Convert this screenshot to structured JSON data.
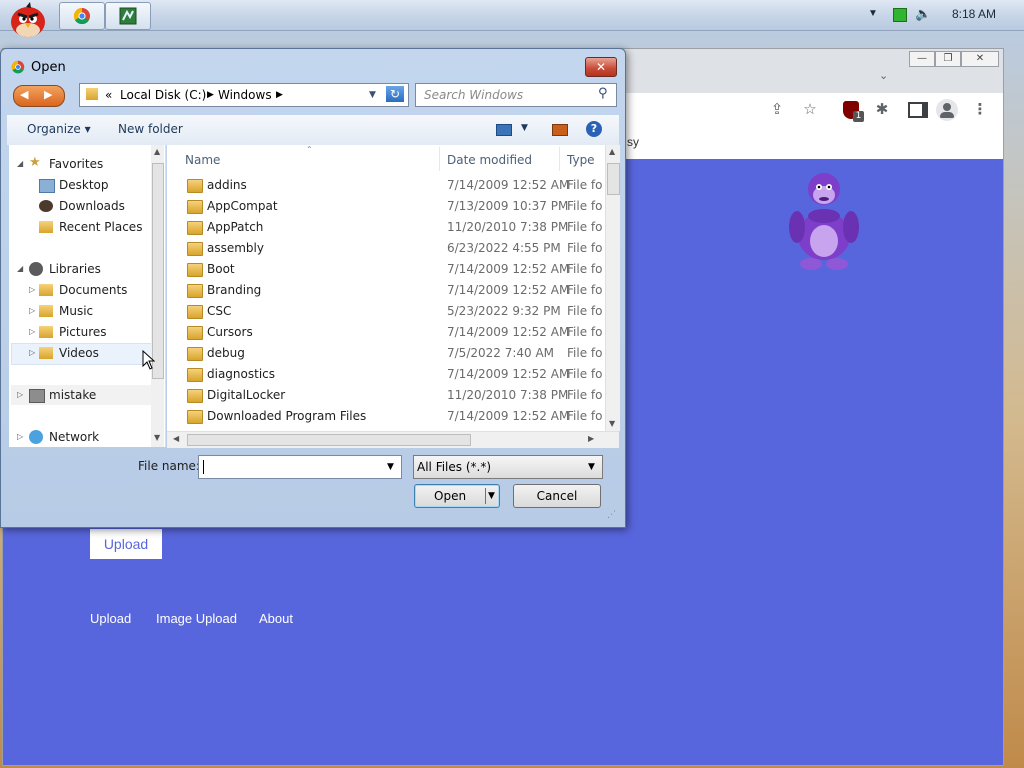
{
  "taskbar": {
    "time": "8:18 AM",
    "icons": [
      "angry-bird-icon",
      "chrome-icon",
      "app-icon",
      "chevron-up-icon",
      "network-icon",
      "speaker-icon"
    ]
  },
  "browser": {
    "bookmark_fragment": "sy",
    "page": {
      "upload_button": "Upload",
      "links": [
        "Upload",
        "Image Upload",
        "About"
      ]
    }
  },
  "dialog": {
    "title": "Open",
    "address": {
      "overflow": "«",
      "segments": [
        "Local Disk (C:)",
        "Windows"
      ]
    },
    "search_placeholder": "Search Windows",
    "toolbar": {
      "organize": "Organize",
      "new_folder": "New folder"
    },
    "nav": {
      "favorites": "Favorites",
      "favorites_items": [
        "Desktop",
        "Downloads",
        "Recent Places"
      ],
      "libraries": "Libraries",
      "libraries_items": [
        "Documents",
        "Music",
        "Pictures",
        "Videos"
      ],
      "mistake": "mistake",
      "network": "Network"
    },
    "columns": {
      "name": "Name",
      "date": "Date modified",
      "type": "Type"
    },
    "files": [
      {
        "name": "addins",
        "date": "7/14/2009 12:52 AM",
        "type": "File fol"
      },
      {
        "name": "AppCompat",
        "date": "7/13/2009 10:37 PM",
        "type": "File fol"
      },
      {
        "name": "AppPatch",
        "date": "11/20/2010 7:38 PM",
        "type": "File fol"
      },
      {
        "name": "assembly",
        "date": "6/23/2022 4:55 PM",
        "type": "File fol"
      },
      {
        "name": "Boot",
        "date": "7/14/2009 12:52 AM",
        "type": "File fol"
      },
      {
        "name": "Branding",
        "date": "7/14/2009 12:52 AM",
        "type": "File fol"
      },
      {
        "name": "CSC",
        "date": "5/23/2022 9:32 PM",
        "type": "File fol"
      },
      {
        "name": "Cursors",
        "date": "7/14/2009 12:52 AM",
        "type": "File fol"
      },
      {
        "name": "debug",
        "date": "7/5/2022 7:40 AM",
        "type": "File fol"
      },
      {
        "name": "diagnostics",
        "date": "7/14/2009 12:52 AM",
        "type": "File fol"
      },
      {
        "name": "DigitalLocker",
        "date": "11/20/2010 7:38 PM",
        "type": "File fol"
      },
      {
        "name": "Downloaded Program Files",
        "date": "7/14/2009 12:52 AM",
        "type": "File fol"
      }
    ],
    "file_name_label": "File name:",
    "file_name_value": "",
    "filter": "All Files (*.*)",
    "open_button": "Open",
    "cancel_button": "Cancel"
  }
}
